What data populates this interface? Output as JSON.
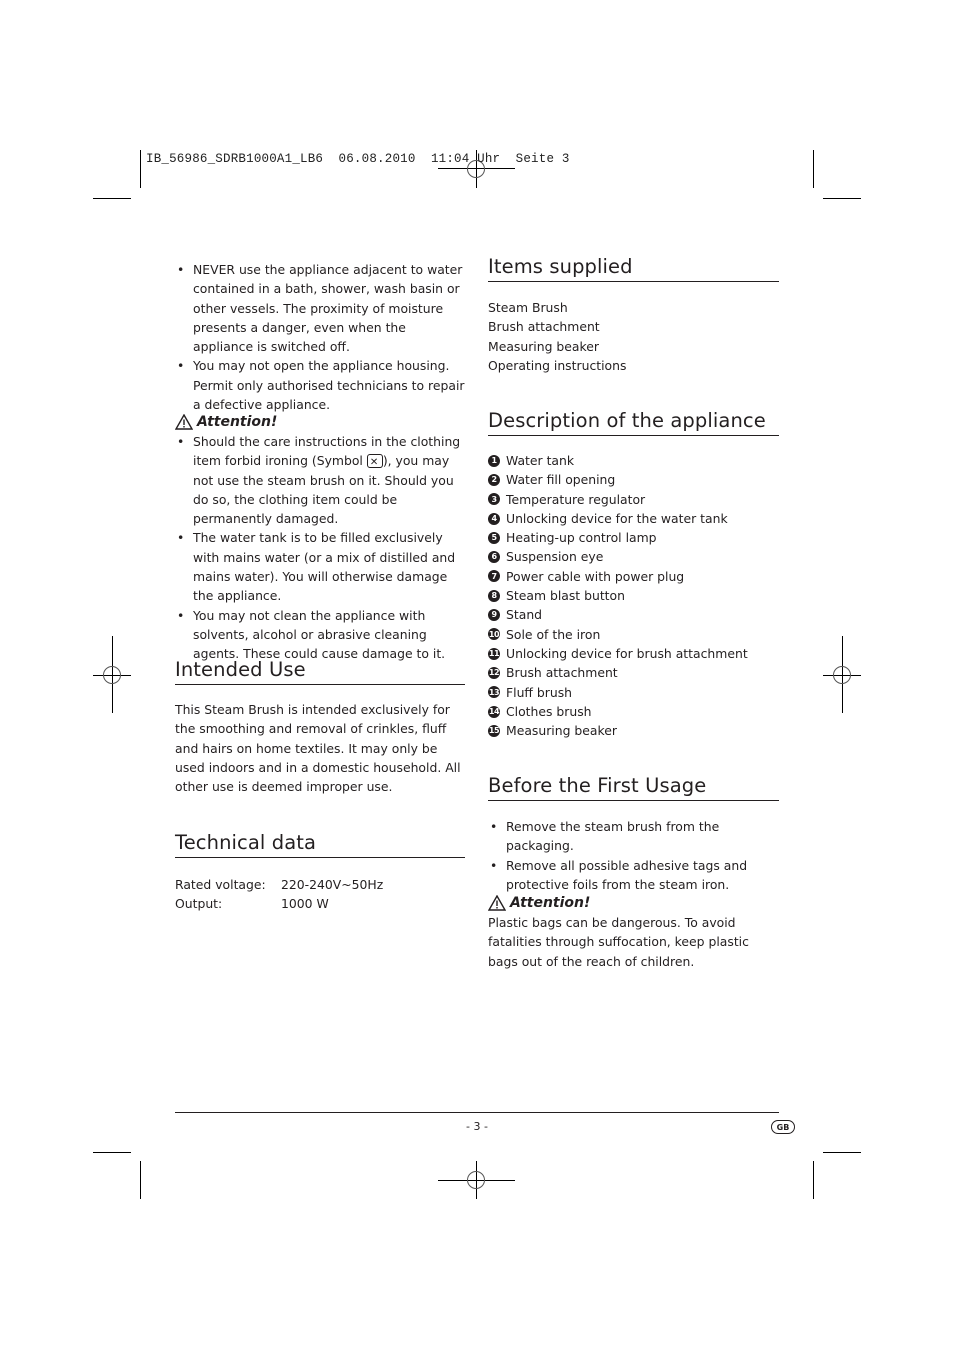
{
  "slug": {
    "text": "IB_56986_SDRB1000A1_LB6  06.08.2010  11:04 Uhr  Seite 3"
  },
  "left": {
    "safety_bullets": [
      "NEVER use the appliance adjacent to water contained in a bath, shower, wash basin or other vessels. The proximity of moisture presents a danger, even when the appliance is switched off.",
      "You may not open the appliance housing. Permit only authorised technicians to repair a defective appliance."
    ],
    "attention1": {
      "title": "Attention!",
      "bullet1_pre": "Should the care instructions in the clothing item forbid ironing (Symbol ",
      "bullet1_post": "), you may not use the steam brush on it. Should you do so, the clothing item could be permanently damaged.",
      "bullets": [
        "The water tank is to be filled exclusively with mains water (or a mix of distilled and mains water). You will otherwise damage the appliance.",
        "You may not clean the appliance with solvents, alcohol or abrasive cleaning agents. These could cause damage to it."
      ]
    },
    "intended_use": {
      "title": "Intended Use",
      "body": "This Steam Brush is intended exclusively for the smoothing and removal of crinkles, fluff and hairs on home textiles. It may only be used indoors and in a domestic household. All other use is deemed improper use."
    },
    "technical_data": {
      "title": "Technical data",
      "rows": [
        {
          "label": "Rated voltage:",
          "value": "220-240V~50Hz"
        },
        {
          "label": "Output:",
          "value": "1000 W"
        }
      ]
    }
  },
  "right": {
    "items_supplied": {
      "title": "Items supplied",
      "items": [
        "Steam Brush",
        "Brush attachment",
        "Measuring beaker",
        "Operating instructions"
      ]
    },
    "description": {
      "title": "Description of the appliance",
      "items": [
        {
          "num": "1",
          "label": "Water tank"
        },
        {
          "num": "2",
          "label": "Water fill opening"
        },
        {
          "num": "3",
          "label": "Temperature regulator"
        },
        {
          "num": "4",
          "label": "Unlocking device for the water tank"
        },
        {
          "num": "5",
          "label": "Heating-up control lamp"
        },
        {
          "num": "6",
          "label": "Suspension eye"
        },
        {
          "num": "7",
          "label": "Power cable with power plug"
        },
        {
          "num": "8",
          "label": "Steam blast button"
        },
        {
          "num": "9",
          "label": "Stand"
        },
        {
          "num": "10",
          "label": "Sole of the iron"
        },
        {
          "num": "11",
          "label": "Unlocking device for brush attachment"
        },
        {
          "num": "12",
          "label": "Brush attachment"
        },
        {
          "num": "13",
          "label": "Fluff brush"
        },
        {
          "num": "14",
          "label": "Clothes brush"
        },
        {
          "num": "15",
          "label": "Measuring beaker"
        }
      ]
    },
    "before_first_usage": {
      "title": "Before the First Usage",
      "bullets": [
        "Remove the steam brush from the packaging.",
        "Remove all possible adhesive tags and protective foils from the steam iron."
      ]
    },
    "attention2": {
      "title": "Attention!",
      "body": "Plastic bags can be dangerous. To avoid fatalities through suffocation, keep plastic bags out of the reach of children."
    }
  },
  "footer": {
    "page_number": "- 3 -",
    "language_badge": "GB"
  }
}
